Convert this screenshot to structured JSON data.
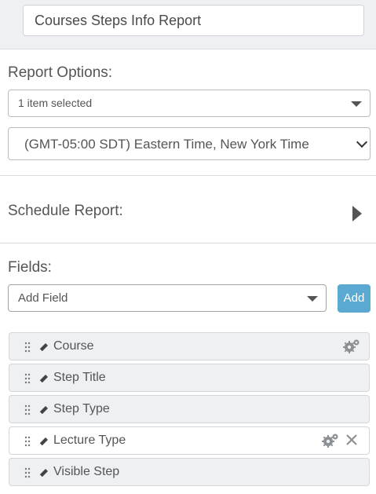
{
  "report": {
    "name": "Courses Steps Info Report"
  },
  "options": {
    "title": "Report Options:",
    "selection": "1 item selected",
    "timezone": "(GMT-05:00 SDT) Eastern Time, New York Time"
  },
  "schedule": {
    "title": "Schedule Report:"
  },
  "fields": {
    "title": "Fields:",
    "add_field_placeholder": "Add Field",
    "add_button": "Add",
    "items": [
      {
        "label": "Course",
        "icons": [
          "gear-icon"
        ]
      },
      {
        "label": "Step Title",
        "icons": []
      },
      {
        "label": "Step Type",
        "icons": []
      },
      {
        "label": "Lecture Type",
        "icons": [
          "gear-icon",
          "close-icon"
        ]
      },
      {
        "label": "Visible Step",
        "icons": []
      }
    ]
  },
  "colors": {
    "accent": "#5aa9d3",
    "row_bg": "#eef0f2",
    "header_bg": "#eef0f3"
  }
}
